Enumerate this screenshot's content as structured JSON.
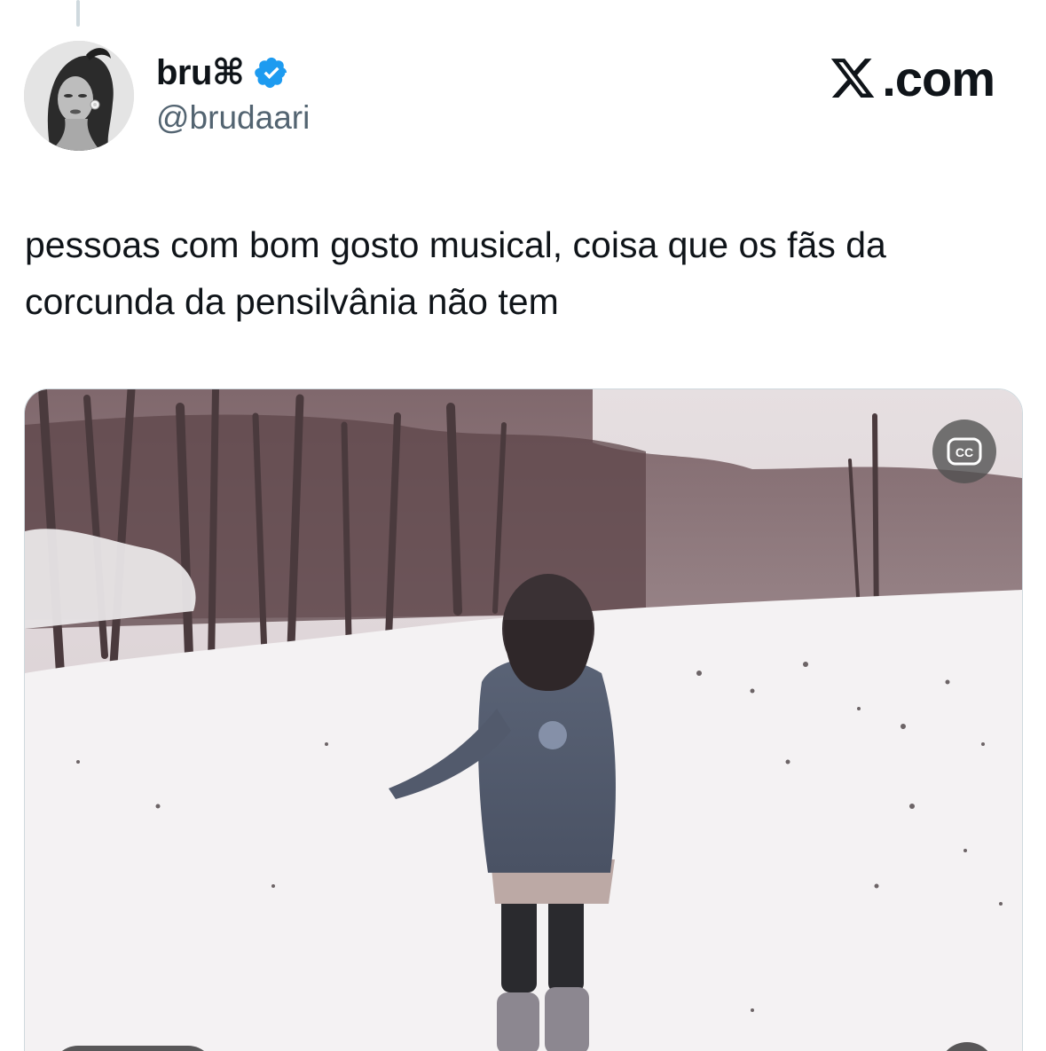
{
  "tweet": {
    "display_name": "bru⌘",
    "handle": "@brudaari",
    "text": "pessoas com bom gosto musical, coisa que os fãs da corcunda da pensilvânia não tem",
    "verified": true
  },
  "brand": {
    "label": ".com"
  },
  "media": {
    "caption_button_label": "CC"
  },
  "colors": {
    "verified_badge": "#1d9bf0",
    "handle_gray": "#536471",
    "text_primary": "#0f1419"
  },
  "icons": {
    "verified": "verified-badge-icon",
    "brand": "x-logo-icon",
    "captions": "closed-captions-icon"
  }
}
